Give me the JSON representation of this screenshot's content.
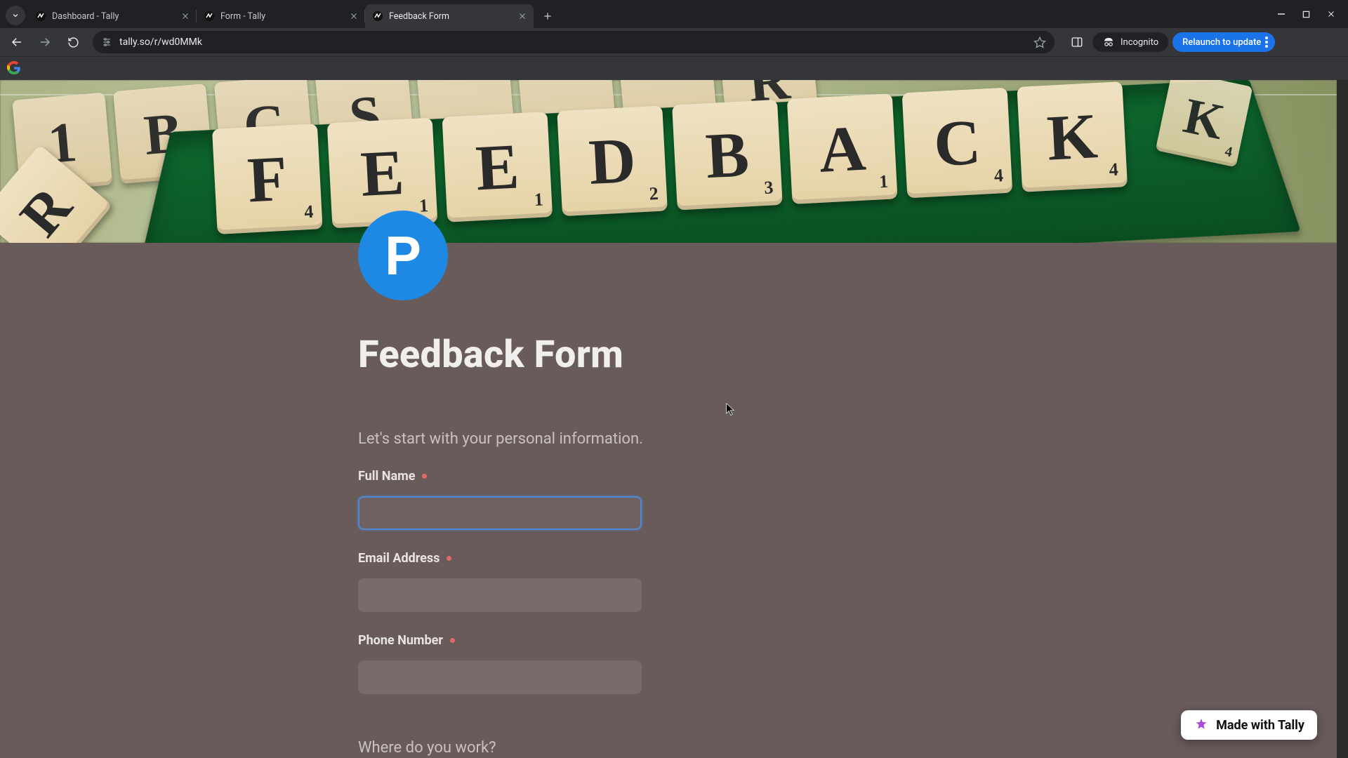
{
  "browser": {
    "tabs": [
      {
        "title": "Dashboard - Tally",
        "active": false
      },
      {
        "title": "Form - Tally",
        "active": false
      },
      {
        "title": "Feedback Form",
        "active": true
      }
    ],
    "url": "tally.so/r/wd0MMk",
    "incognito_label": "Incognito",
    "relaunch_label": "Relaunch to update"
  },
  "cover": {
    "tiles_word": [
      "F",
      "E",
      "E",
      "D",
      "B",
      "A",
      "C",
      "K"
    ],
    "tiles_sub": [
      "4",
      "1",
      "1",
      "2",
      "3",
      "1",
      "4",
      "4"
    ],
    "back_row": [
      "1",
      "B",
      "C",
      "S",
      "",
      "",
      "",
      "R",
      "4"
    ]
  },
  "logo": {
    "letter": "P"
  },
  "form": {
    "title": "Feedback Form",
    "subtitle": "Let's start with your personal information.",
    "fields": [
      {
        "label": "Full Name",
        "required": true,
        "focused": true
      },
      {
        "label": "Email Address",
        "required": true,
        "focused": false
      },
      {
        "label": "Phone Number",
        "required": true,
        "focused": false
      }
    ],
    "next_question": "Where do you work?"
  },
  "badge": {
    "label": "Made with Tally"
  }
}
